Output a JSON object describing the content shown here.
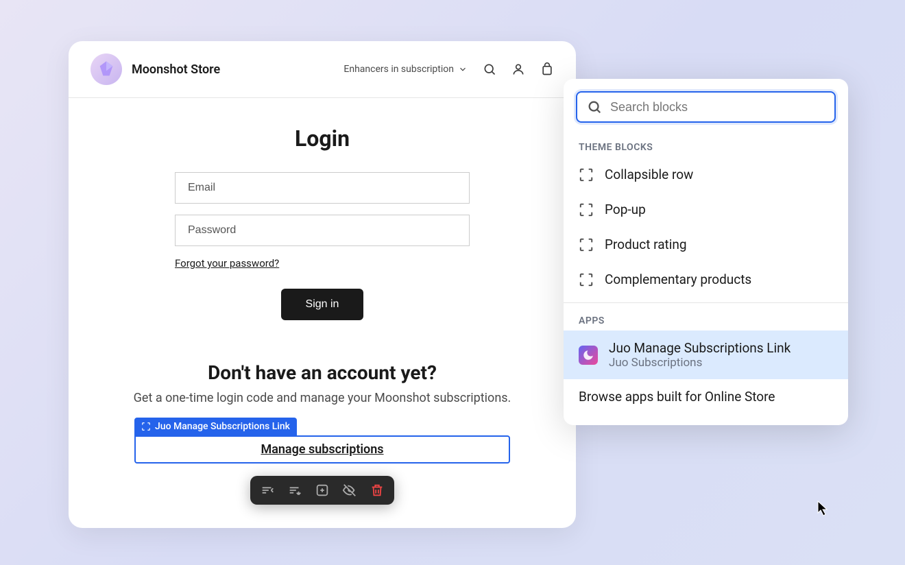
{
  "store": {
    "name": "Moonshot Store",
    "navDropdown": "Enhancers in subscription"
  },
  "login": {
    "title": "Login",
    "emailPlaceholder": "Email",
    "passwordPlaceholder": "Password",
    "forgotLink": "Forgot your password?",
    "signinLabel": "Sign in"
  },
  "signup": {
    "title": "Don't have an account yet?",
    "subtitle": "Get a one-time login code and manage your Moonshot subscriptions."
  },
  "selectedBlock": {
    "label": "Juo Manage Subscriptions Link",
    "linkText": "Manage subscriptions"
  },
  "panel": {
    "searchPlaceholder": "Search blocks",
    "sectionThemeBlocks": "THEME BLOCKS",
    "sectionApps": "APPS",
    "themeBlocks": [
      {
        "label": "Collapsible row"
      },
      {
        "label": "Pop-up"
      },
      {
        "label": "Product rating"
      },
      {
        "label": "Complementary products"
      }
    ],
    "appBlock": {
      "title": "Juo Manage Subscriptions Link",
      "subtitle": "Juo Subscriptions"
    },
    "browseLink": "Browse apps built for Online Store"
  }
}
